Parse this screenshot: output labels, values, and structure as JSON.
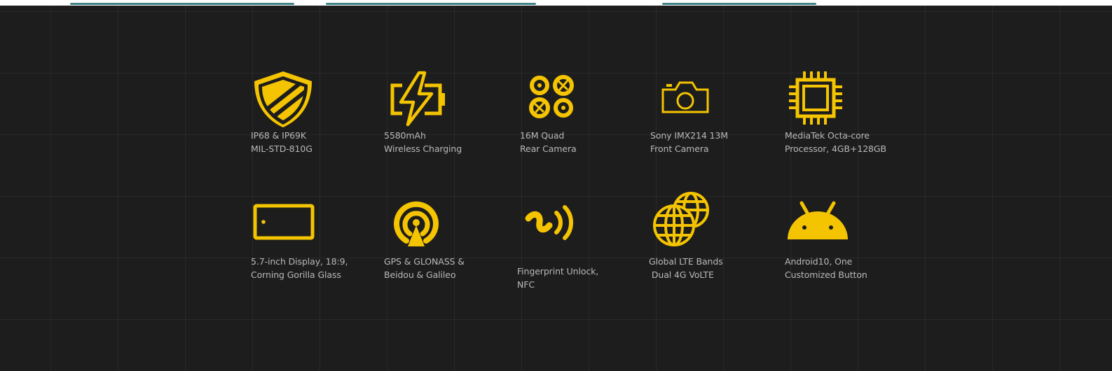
{
  "accent_color": "#f5c400",
  "background_color": "#1d1d1d",
  "features": [
    {
      "icon": "shield-icon",
      "line1": "IP68 & IP69K",
      "line2": "MIL-STD-810G"
    },
    {
      "icon": "battery-charging-icon",
      "line1": "5580mAh",
      "line2": "Wireless Charging"
    },
    {
      "icon": "quad-camera-icon",
      "line1": "16M Quad",
      "line2": "Rear Camera"
    },
    {
      "icon": "camera-icon",
      "line1": "Sony IMX214 13M",
      "line2": "Front Camera"
    },
    {
      "icon": "processor-chip-icon",
      "line1": "MediaTek Octa-core",
      "line2": "Processor, 4GB+128GB"
    },
    {
      "icon": "display-icon",
      "line1": "5.7-inch Display, 18:9,",
      "line2": "Corning Gorilla Glass"
    },
    {
      "icon": "gps-icon",
      "line1": "GPS & GLONASS &",
      "line2": "Beidou & Galileo"
    },
    {
      "icon": "nfc-icon",
      "line1": "Fingerprint Unlock,",
      "line2": "NFC"
    },
    {
      "icon": "globe-lte-icon",
      "line1": "Global LTE Bands",
      "line2": " Dual 4G VoLTE"
    },
    {
      "icon": "android-icon",
      "line1": "Android10, One",
      "line2": "Customized Button"
    }
  ]
}
